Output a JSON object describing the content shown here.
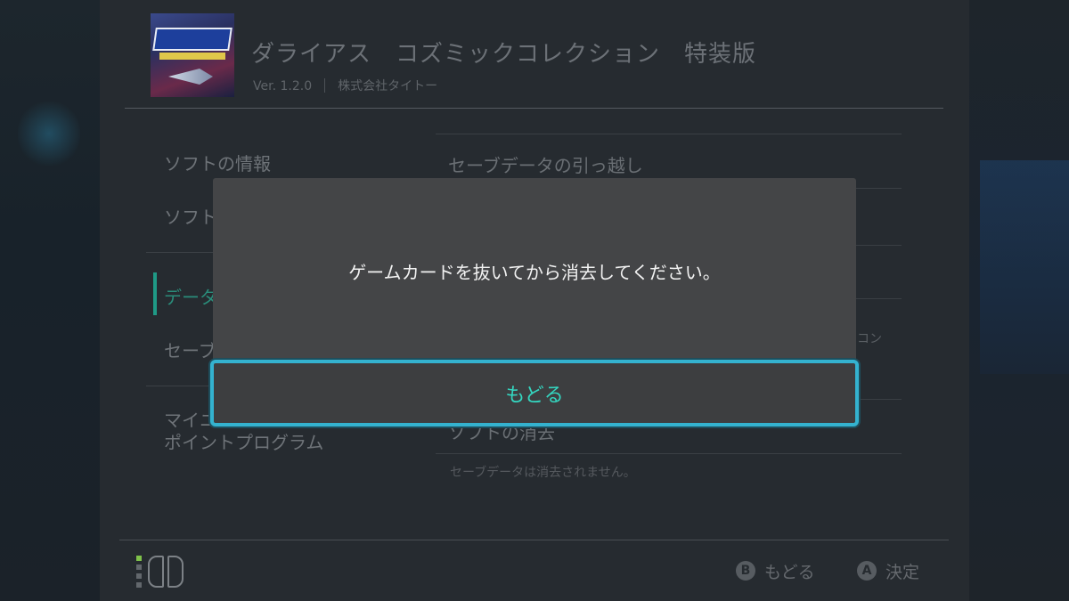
{
  "header": {
    "game_title": "ダライアス　コズミックコレクション　特装版",
    "version": "Ver. 1.2.0",
    "publisher": "株式会社タイトー",
    "icon": "game-cover-icon"
  },
  "left_menu": {
    "items": [
      {
        "label": "ソフトの情報",
        "active": false
      },
      {
        "label": "ソフト",
        "active": false
      },
      {
        "label": "データ",
        "active": true
      },
      {
        "label": "セーブ",
        "active": false
      },
      {
        "label": "マイニ",
        "active": false
      },
      {
        "label": "ポイントプログラム",
        "active": false
      }
    ]
  },
  "right_content": {
    "rows": [
      {
        "label": "セーブデータの引っ越し"
      },
      {
        "label": "ソフトの消去"
      }
    ],
    "note": "セーブデータは消去されません。",
    "partial_text": "コン"
  },
  "dialog": {
    "message": "ゲームカードを抜いてから消去してください。",
    "button_label": "もどる"
  },
  "footer": {
    "back_key": "B",
    "back_label": "もどる",
    "ok_key": "A",
    "ok_label": "決定"
  },
  "colors": {
    "accent": "#34b2cf",
    "button_text": "#34d6c0",
    "active_menu": "#1f9a86"
  }
}
